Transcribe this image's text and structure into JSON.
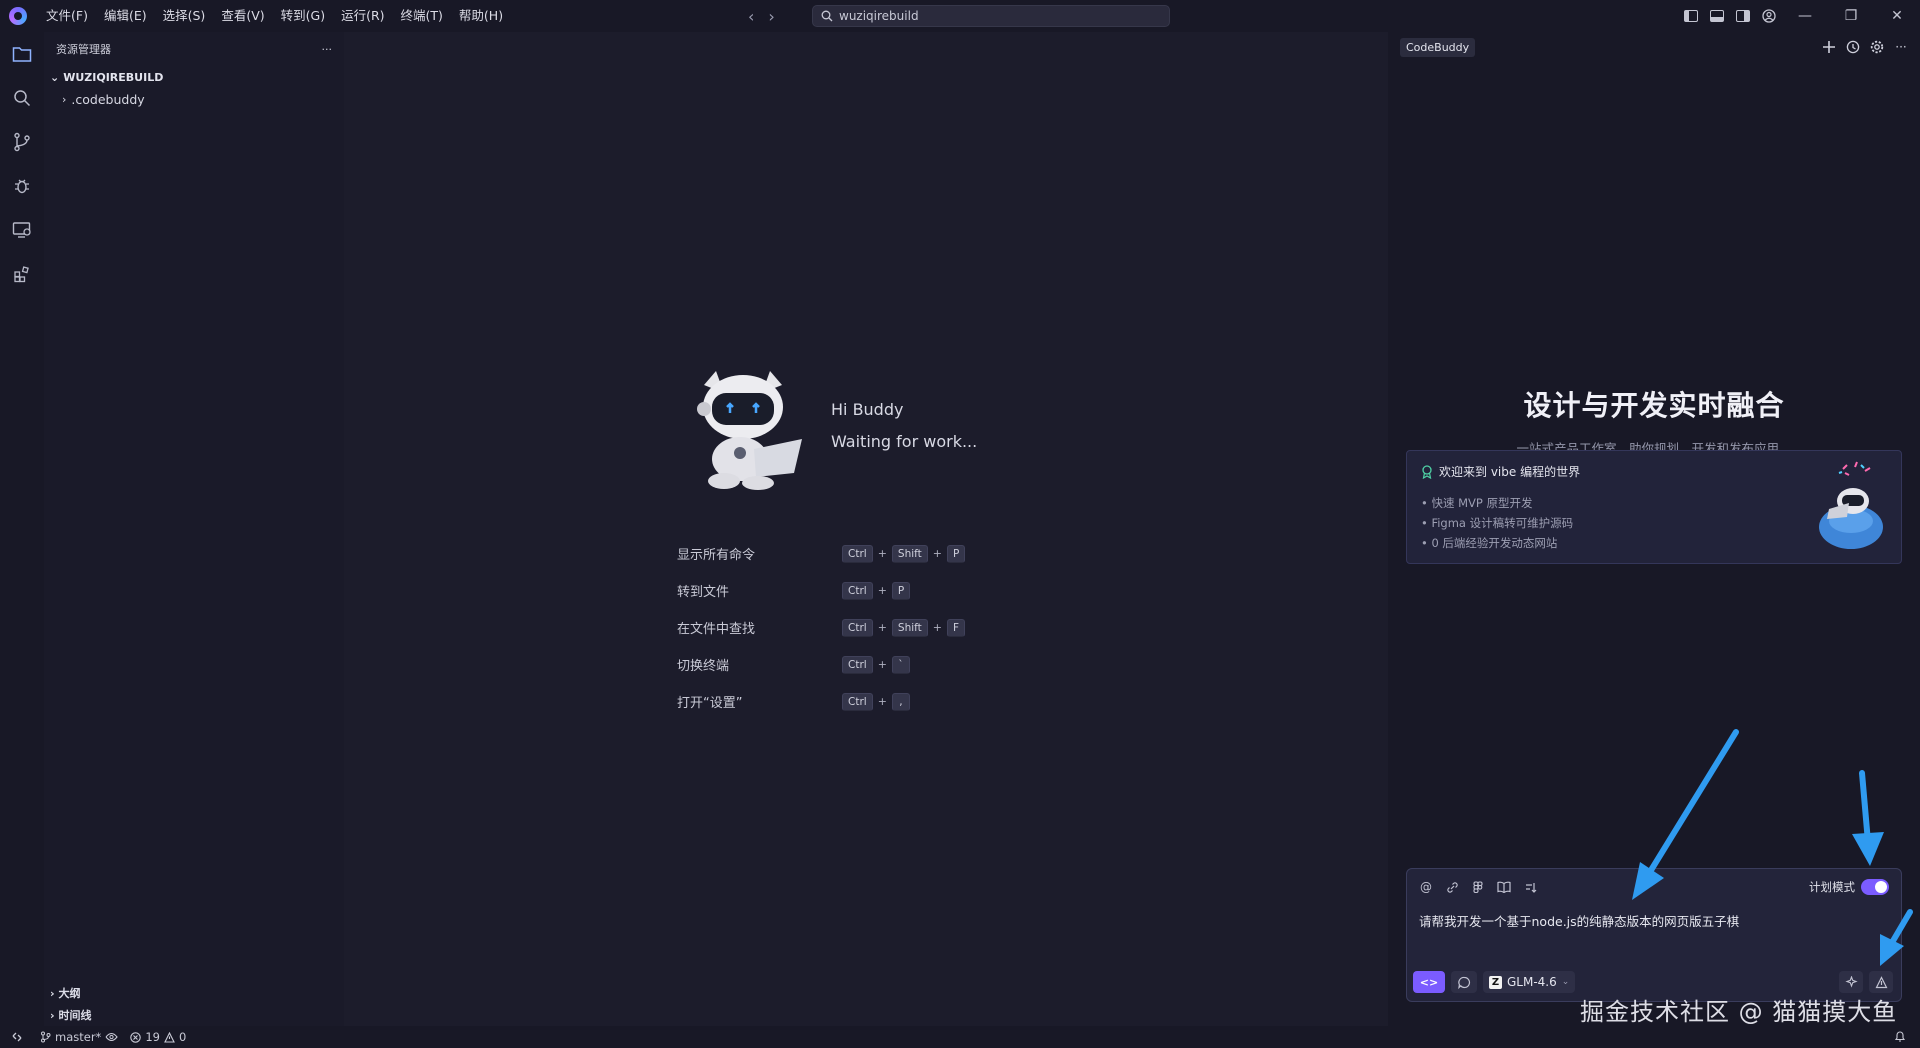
{
  "titlebar": {
    "menus": [
      "文件(F)",
      "编辑(E)",
      "选择(S)",
      "查看(V)",
      "转到(G)",
      "运行(R)",
      "终端(T)",
      "帮助(H)"
    ],
    "search_text": "wuziqirebuild",
    "accent": "#7b5cff"
  },
  "sidebar": {
    "title": "资源管理器",
    "more": "···",
    "root": "WUZIQIREBUILD",
    "items": [
      ".codebuddy"
    ],
    "sections": [
      "大纲",
      "时间线"
    ]
  },
  "editor": {
    "greeting_1": "Hi Buddy",
    "greeting_2": "Waiting for work...",
    "shortcuts": [
      {
        "label": "显示所有命令",
        "keys": [
          "Ctrl",
          "Shift",
          "P"
        ]
      },
      {
        "label": "转到文件",
        "keys": [
          "Ctrl",
          "P"
        ]
      },
      {
        "label": "在文件中查找",
        "keys": [
          "Ctrl",
          "Shift",
          "F"
        ]
      },
      {
        "label": "切换终端",
        "keys": [
          "Ctrl",
          "`"
        ]
      },
      {
        "label": "打开“设置”",
        "keys": [
          "Ctrl",
          ","
        ]
      }
    ]
  },
  "right_panel": {
    "tab": "CodeBuddy",
    "hero_title": "设计与开发实时融合",
    "hero_subtitle": "一站式产品工作室，助你规划、开发和发布应用。",
    "card_title": "欢迎来到 vibe 编程的世界",
    "card_items": [
      "快速 MVP 原型开发",
      "Figma 设计稿转可维护源码",
      "0 后端经验开发动态网站"
    ],
    "plan_mode_label": "计划模式",
    "plan_mode_on": true,
    "prompt_text": "请帮我开发一个基于node.js的纯静态版本的网页版五子棋",
    "mode_label": "<>",
    "model_name": "GLM-4.6",
    "model_logo": "Z"
  },
  "watermark": "掘金技术社区 @ 猫猫摸大鱼",
  "statusbar": {
    "branch": "master*",
    "errors": "19",
    "warnings": "0"
  },
  "colors": {
    "annotation_arrow": "#2f9bf0"
  }
}
